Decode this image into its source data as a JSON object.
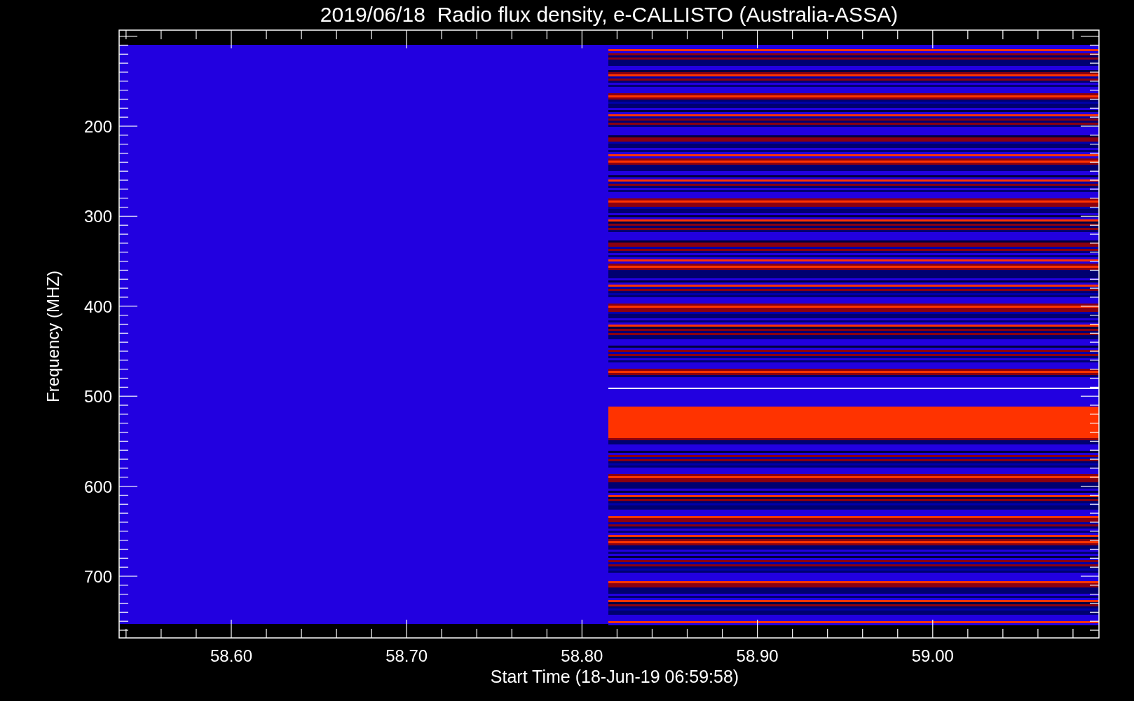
{
  "plot": {
    "title": "2019/06/18  Radio flux density, e-CALLISTO (Australia-ASSA)",
    "xlabel": "Start Time (18-Jun-19 06:59:58)",
    "ylabel": "Frequency (MHZ)",
    "xticks": [
      "58.60",
      "58.70",
      "58.80",
      "58.90",
      "59.00"
    ],
    "yticks": [
      "200",
      "300",
      "400",
      "500",
      "600",
      "700"
    ]
  }
}
